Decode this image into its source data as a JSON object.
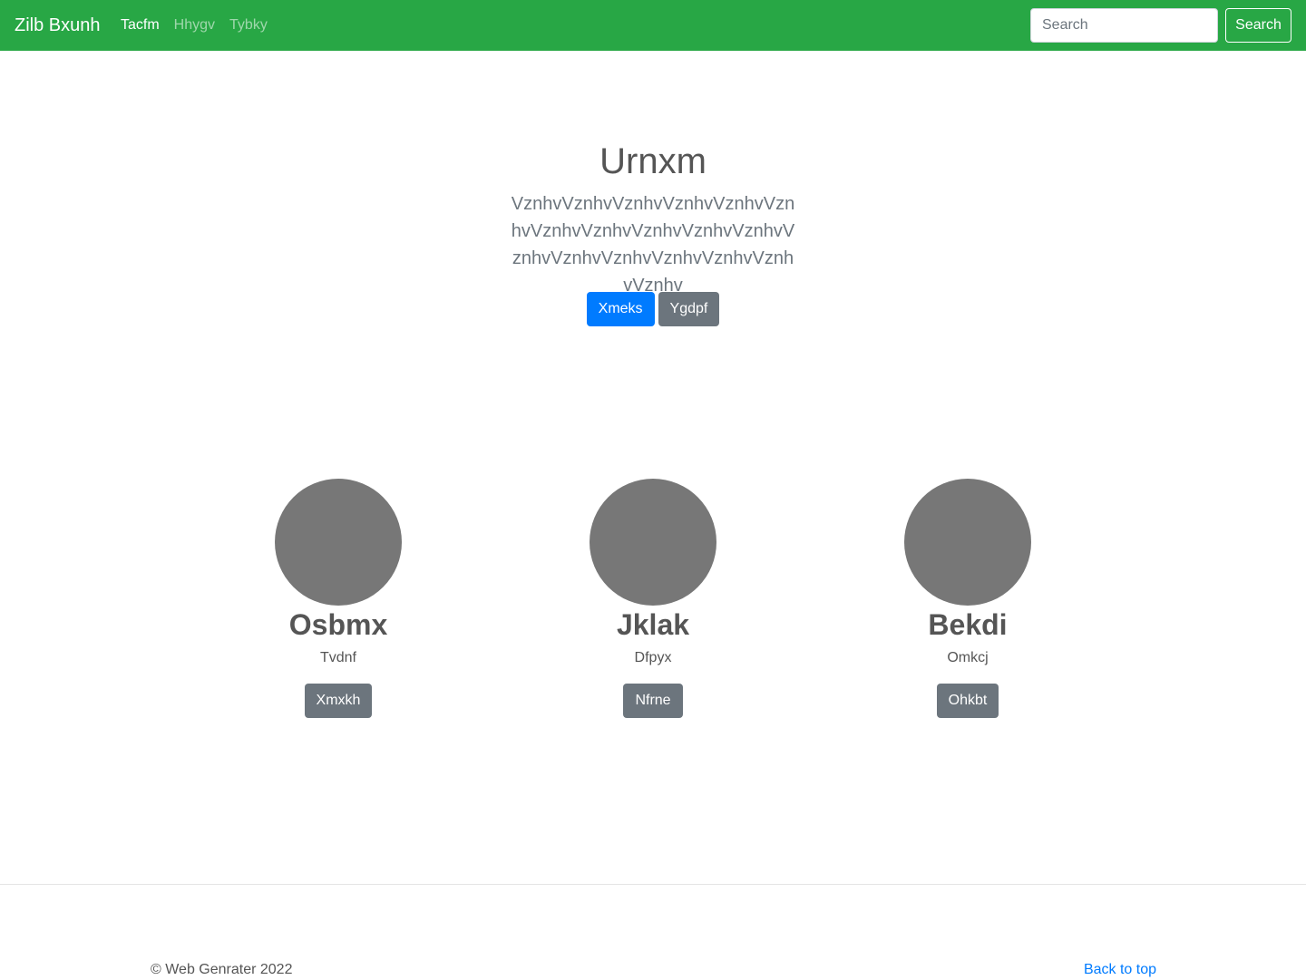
{
  "navbar": {
    "brand": "Zilb Bxunh",
    "links": [
      {
        "label": "Tacfm",
        "active": true
      },
      {
        "label": "Hhygv",
        "active": false
      },
      {
        "label": "Tybky",
        "active": false
      }
    ],
    "search_placeholder": "Search",
    "search_button": "Search",
    "color": "#28a745"
  },
  "hero": {
    "title": "Urnxm",
    "text": "VznhvVznhvVznhvVznhvVznhvVznhvVznhvVznhvVznhvVznhvVznhvVznhvVznhvVznhvVznhvVznhvVznhvVznhv",
    "primary_button": "Xmeks",
    "secondary_button": "Ygdpf"
  },
  "cards": [
    {
      "name": "Osbmx",
      "subtitle": "Tvdnf",
      "button": "Xmxkh"
    },
    {
      "name": "Jklak",
      "subtitle": "Dfpyx",
      "button": "Nfrne"
    },
    {
      "name": "Bekdi",
      "subtitle": "Omkcj",
      "button": "Ohkbt"
    }
  ],
  "footer": {
    "copyright": "© Web Genrater 2022",
    "back_to_top": "Back to top"
  }
}
